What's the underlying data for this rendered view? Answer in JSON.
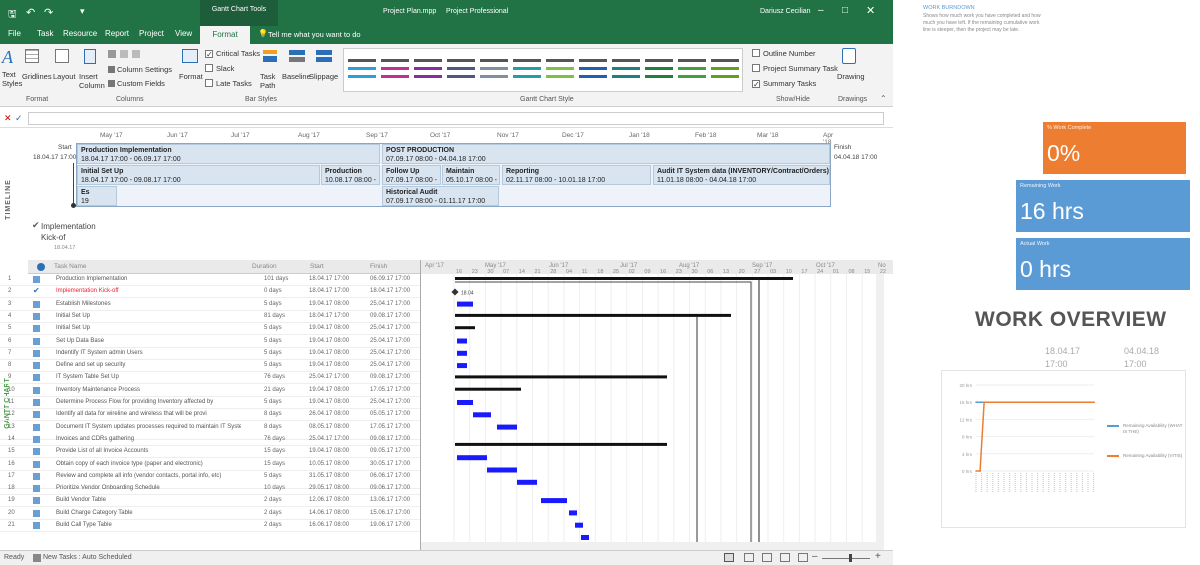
{
  "title_bar": {
    "context_tab": "Gantt Chart Tools",
    "file_name": "Project Plan.mpp",
    "app_name": "Project Professional",
    "user": "Dariusz Cecilian"
  },
  "tabs": [
    "File",
    "Task",
    "Resource",
    "Report",
    "Project",
    "View",
    "Format"
  ],
  "tell_me": "Tell me what you want to do",
  "ribbon": {
    "text_styles": "Text Styles",
    "gridlines": "Gridlines",
    "layout": "Layout",
    "insert_column": "Insert Column",
    "column_settings": "Column Settings",
    "custom_fields": "Custom Fields",
    "critical_tasks": "Critical Tasks",
    "slack": "Slack",
    "late_tasks": "Late Tasks",
    "task_path": "Task Path",
    "baseline": "Baseline",
    "slippage": "Slippage",
    "format": "Format",
    "outline_number": "Outline Number",
    "project_summary_task": "Project Summary Task",
    "summary_tasks": "Summary Tasks",
    "drawing": "Drawing",
    "groups": {
      "format": "Format",
      "columns": "Columns",
      "bar_styles": "Bar Styles",
      "gantt_style": "Gantt Chart Style",
      "show_hide": "Show/Hide",
      "drawings": "Drawings"
    }
  },
  "timeline": {
    "label": "TIMELINE",
    "start_label": "Start",
    "start_date": "18.04.17 17:00",
    "finish_label": "Finish",
    "finish_date": "04.04.18 17:00",
    "months": [
      "May '17",
      "Jun '17",
      "Jul '17",
      "Aug '17",
      "Sep '17",
      "Oct '17",
      "Nov '17",
      "Dec '17",
      "Jan '18",
      "Feb '18",
      "Mar '18",
      "Apr '18"
    ],
    "boxes": [
      {
        "title": "Production Implementation",
        "dates": "18.04.17 17:00 - 06.09.17 17:00"
      },
      {
        "title": "POST PRODUCTION",
        "dates": "07.09.17 08:00 - 04.04.18 17:00"
      },
      {
        "title": "Initial Set Up",
        "dates": "18.04.17 17:00 - 09.08.17 17:00"
      },
      {
        "title": "Production",
        "dates": "10.08.17 08:00 -"
      },
      {
        "title": "Follow Up",
        "dates": "07.09.17 08:00 -"
      },
      {
        "title": "Maintain",
        "dates": "05.10.17 08:00 -"
      },
      {
        "title": "Reporting",
        "dates": "02.11.17 08:00 - 10.01.18 17:00"
      },
      {
        "title": "Audit IT System data (INVENTORY/Contract/Orders)",
        "dates": "11.01.18 08:00 - 04.04.18 17:00"
      },
      {
        "title": "Es",
        "dates": "19"
      },
      {
        "title": "Historical Audit",
        "dates": "07.09.17 08:00 - 01.11.17 17:00"
      }
    ],
    "milestone": "Implementation Kick-of",
    "milestone_date": "18.04.17"
  },
  "grid": {
    "side_label": "GANTT CHART",
    "columns": [
      "Task Name",
      "Duration",
      "Start",
      "Finish"
    ],
    "rows": [
      {
        "id": "1",
        "name": "Production Implementation",
        "duration": "101 days",
        "start": "18.04.17 17:00",
        "finish": "06.09.17 17:00"
      },
      {
        "id": "2",
        "name": "Implementation Kick-off",
        "duration": "0 days",
        "start": "18.04.17 17:00",
        "finish": "18.04.17 17:00"
      },
      {
        "id": "3",
        "name": "Establish Milestones",
        "duration": "5 days",
        "start": "19.04.17 08:00",
        "finish": "25.04.17 17:00"
      },
      {
        "id": "4",
        "name": "Initial Set Up",
        "duration": "81 days",
        "start": "18.04.17 17:00",
        "finish": "09.08.17 17:00"
      },
      {
        "id": "5",
        "name": "Initial Set Up",
        "duration": "5 days",
        "start": "19.04.17 08:00",
        "finish": "25.04.17 17:00"
      },
      {
        "id": "6",
        "name": "Set Up Data Base",
        "duration": "5 days",
        "start": "19.04.17 08:00",
        "finish": "25.04.17 17:00"
      },
      {
        "id": "7",
        "name": "Indentify IT System admin Users",
        "duration": "5 days",
        "start": "19.04.17 08:00",
        "finish": "25.04.17 17:00"
      },
      {
        "id": "8",
        "name": "Define and set up security",
        "duration": "5 days",
        "start": "19.04.17 08:00",
        "finish": "25.04.17 17:00"
      },
      {
        "id": "9",
        "name": "IT System Table Set Up",
        "duration": "76 days",
        "start": "25.04.17 17:00",
        "finish": "09.08.17 17:00"
      },
      {
        "id": "10",
        "name": "Inventory Maintenance Process",
        "duration": "21 days",
        "start": "19.04.17 08:00",
        "finish": "17.05.17 17:00"
      },
      {
        "id": "11",
        "name": "Determine Process Flow for providing Inventory affected by",
        "duration": "5 days",
        "start": "19.04.17 08:00",
        "finish": "25.04.17 17:00"
      },
      {
        "id": "12",
        "name": "Identify all data for wireline and wireless that will be provi",
        "duration": "8 days",
        "start": "26.04.17 08:00",
        "finish": "05.05.17 17:00"
      },
      {
        "id": "13",
        "name": "Document IT System updates processes required to maintain IT System database",
        "duration": "8 days",
        "start": "08.05.17 08:00",
        "finish": "17.05.17 17:00"
      },
      {
        "id": "14",
        "name": "Invoices and CDRs gathering",
        "duration": "76 days",
        "start": "25.04.17 17:00",
        "finish": "09.08.17 17:00"
      },
      {
        "id": "15",
        "name": "Provide List of all Invoice Accounts",
        "duration": "15 days",
        "start": "19.04.17 08:00",
        "finish": "09.05.17 17:00"
      },
      {
        "id": "16",
        "name": "Obtain copy of each invoice type (paper and electronic)",
        "duration": "15 days",
        "start": "10.05.17 08:00",
        "finish": "30.05.17 17:00"
      },
      {
        "id": "17",
        "name": "Review and complete all info (vendor contacts, portal info, etc)",
        "duration": "5 days",
        "start": "31.05.17 08:00",
        "finish": "06.06.17 17:00"
      },
      {
        "id": "18",
        "name": "Prioritize Vendor Onboarding Schedule",
        "duration": "10 days",
        "start": "29.05.17 08:00",
        "finish": "09.06.17 17:00"
      },
      {
        "id": "19",
        "name": "Build Vendor Table",
        "duration": "2 days",
        "start": "12.06.17 08:00",
        "finish": "13.06.17 17:00"
      },
      {
        "id": "20",
        "name": "Build Charge Category Table",
        "duration": "2 days",
        "start": "14.06.17 08:00",
        "finish": "15.06.17 17:00"
      },
      {
        "id": "21",
        "name": "Build Call Type Table",
        "duration": "2 days",
        "start": "16.06.17 08:00",
        "finish": "19.06.17 17:00"
      }
    ]
  },
  "gantt": {
    "months": [
      "Apr '17",
      "May '17",
      "Jun '17",
      "Jul '17",
      "Aug '17",
      "Sep '17",
      "Oct '17",
      "No"
    ],
    "days": [
      "16",
      "23",
      "30",
      "07",
      "14",
      "21",
      "28",
      "04",
      "11",
      "18",
      "25",
      "02",
      "09",
      "16",
      "23",
      "30",
      "06",
      "13",
      "20",
      "27",
      "03",
      "10",
      "17",
      "24",
      "01",
      "08",
      "15",
      "22",
      "29"
    ],
    "milestone_label": "18.04"
  },
  "status": {
    "ready": "Ready",
    "new_tasks": "New Tasks : Auto Scheduled"
  },
  "dashboard": {
    "header": "WORK BURNDOWN",
    "intro": "Shows how much work you have completed and how much you have left. If the remaining cumulative work line is steeper, then the project may be late.",
    "cards": [
      {
        "label": "% Work Complete",
        "value": "0%",
        "color": "#ed7d31"
      },
      {
        "label": "Remaining Work",
        "value": "16 hrs",
        "color": "#5b9bd5"
      },
      {
        "label": "Actual Work",
        "value": "0 hrs",
        "color": "#5b9bd5"
      }
    ],
    "overview_title": "WORK OVERVIEW",
    "start_date": "18.04.17 17:00",
    "finish_date": "04.04.18 17:00",
    "chart_legend": [
      "Remaining Availability (WHAT IS THE)",
      "Remaining Availability (VITIS)"
    ]
  },
  "chart_data": {
    "type": "line",
    "title": "",
    "yticks": [
      "0 hrs",
      "4 hrs",
      "8 hrs",
      "12 hrs",
      "16 hrs",
      "20 hrs"
    ],
    "ylim": [
      0,
      20
    ],
    "series": [
      {
        "name": "Remaining Availability (WHAT IS THE)",
        "color": "#5b9bd5",
        "values": [
          16,
          16,
          16,
          16,
          16,
          16,
          16,
          16,
          16,
          16,
          16,
          16,
          16,
          16,
          16,
          16,
          16,
          16,
          16,
          16,
          16,
          16,
          16,
          16,
          16,
          16,
          16,
          16,
          16,
          16
        ]
      },
      {
        "name": "Remaining Availability (VITIS)",
        "color": "#ed7d31",
        "values": [
          0,
          0,
          16,
          16,
          16,
          16,
          16,
          16,
          16,
          16,
          16,
          16,
          16,
          16,
          16,
          16,
          16,
          16,
          16,
          16,
          16,
          16,
          16,
          16,
          16,
          16,
          16,
          16,
          16,
          16
        ]
      }
    ]
  }
}
